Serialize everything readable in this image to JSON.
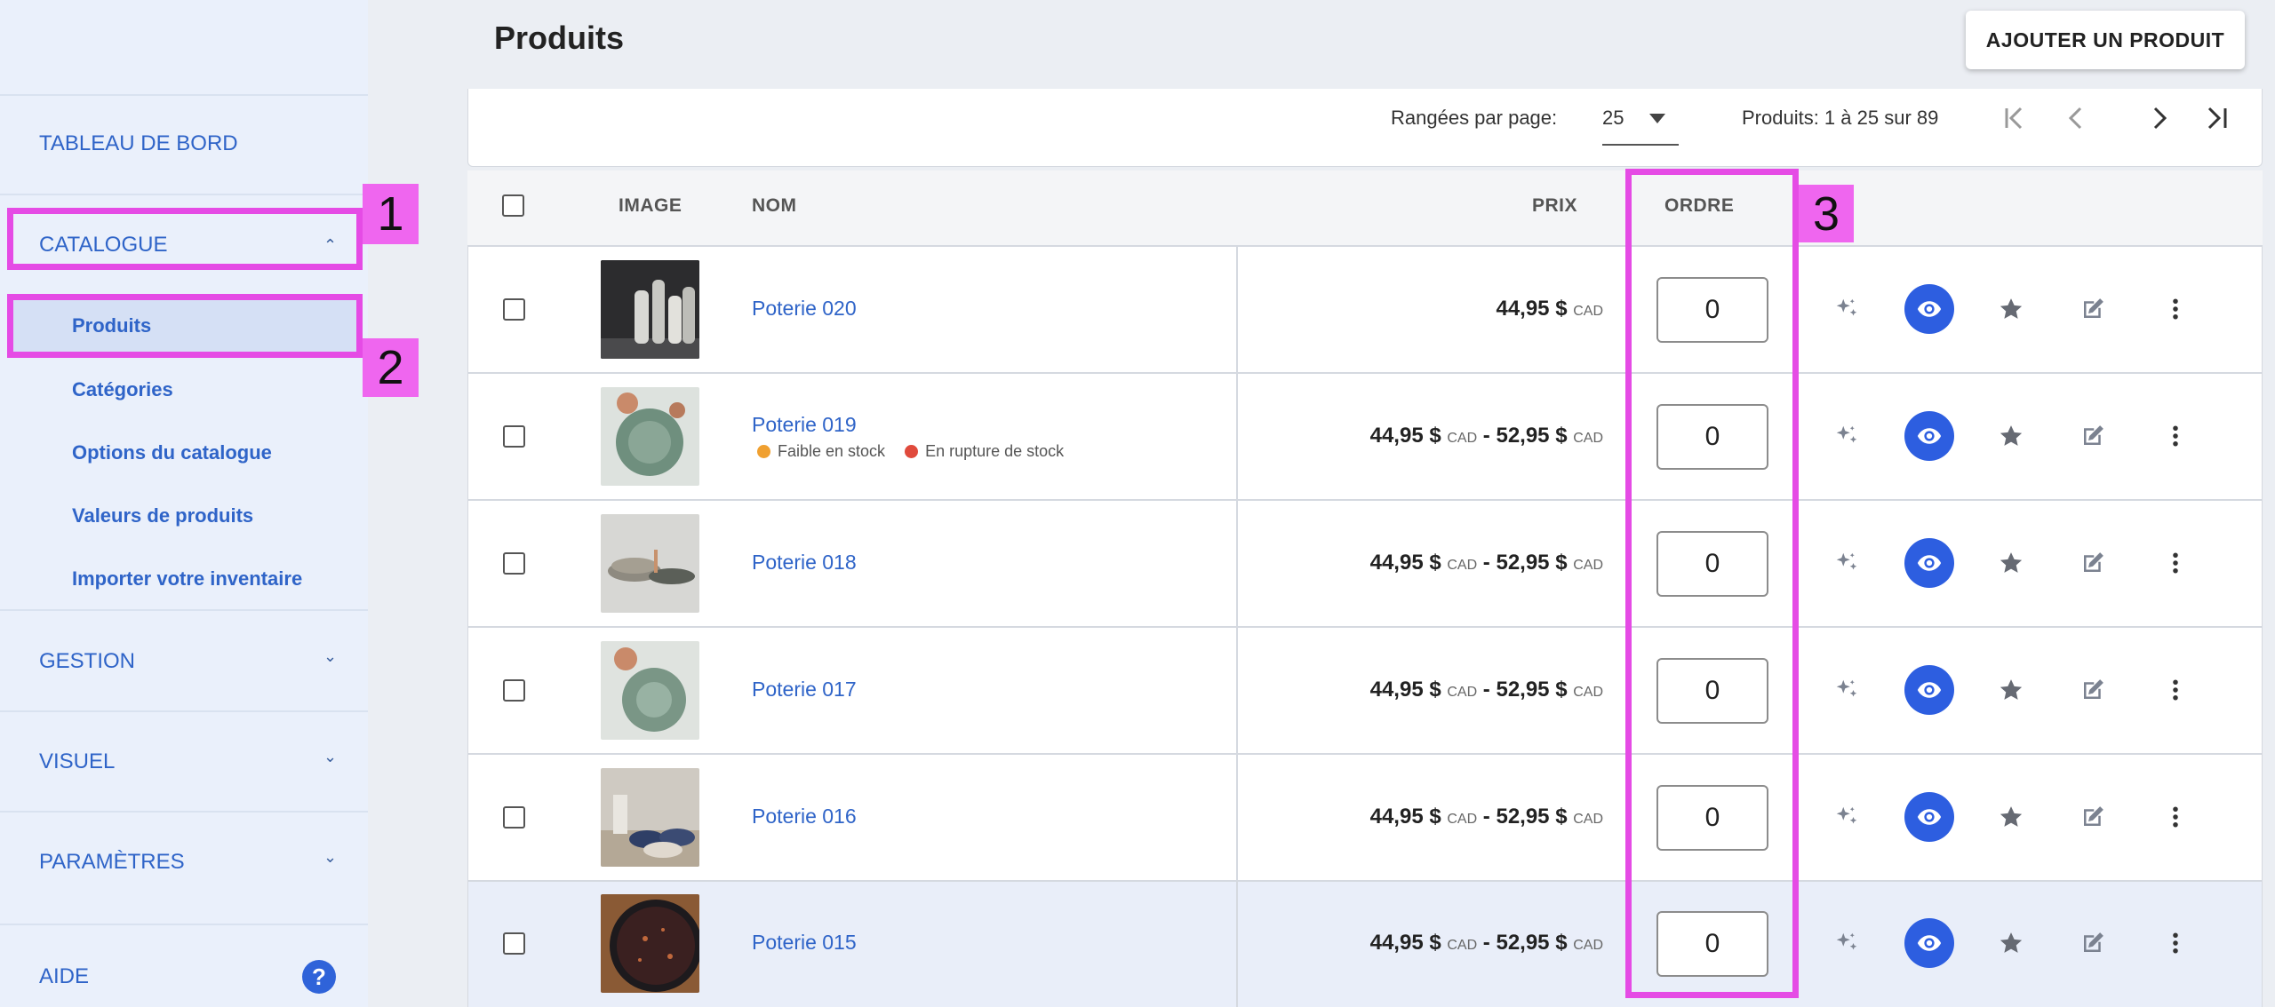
{
  "sidebar": {
    "dashboard": "TABLEAU DE BORD",
    "catalogue": "CATALOGUE",
    "catalogue_items": [
      "Produits",
      "Catégories",
      "Options du catalogue",
      "Valeurs de produits",
      "Importer votre inventaire"
    ],
    "gestion": "GESTION",
    "visuel": "VISUEL",
    "parametres": "PARAMÈTRES",
    "aide": "AIDE",
    "help_glyph": "?",
    "chevron_up": "⌃",
    "chevron_down": "⌄"
  },
  "header": {
    "title": "Produits",
    "add_button": "AJOUTER UN PRODUIT"
  },
  "pagination": {
    "rows_per_page_label": "Rangées par page:",
    "rows_per_page_value": "25",
    "info": "Produits: 1 à 25 sur 89"
  },
  "table": {
    "headers": {
      "image": "IMAGE",
      "name": "NOM",
      "price": "PRIX",
      "order": "ORDRE"
    },
    "rows": [
      {
        "name": "Poterie 020",
        "price_from": "44,95 $",
        "price_to": "",
        "currency": "CAD",
        "order": "0",
        "badges": []
      },
      {
        "name": "Poterie 019",
        "price_from": "44,95 $",
        "price_to": "52,95 $",
        "currency": "CAD",
        "order": "0",
        "badges": [
          {
            "label": "Faible en stock",
            "color": "#f0a030"
          },
          {
            "label": "En rupture de stock",
            "color": "#e04a3c"
          }
        ]
      },
      {
        "name": "Poterie 018",
        "price_from": "44,95 $",
        "price_to": "52,95 $",
        "currency": "CAD",
        "order": "0",
        "badges": []
      },
      {
        "name": "Poterie 017",
        "price_from": "44,95 $",
        "price_to": "52,95 $",
        "currency": "CAD",
        "order": "0",
        "badges": []
      },
      {
        "name": "Poterie 016",
        "price_from": "44,95 $",
        "price_to": "52,95 $",
        "currency": "CAD",
        "order": "0",
        "badges": []
      },
      {
        "name": "Poterie 015",
        "price_from": "44,95 $",
        "price_to": "52,95 $",
        "currency": "CAD",
        "order": "0",
        "badges": []
      }
    ],
    "price_separator": " - "
  },
  "annotations": [
    "1",
    "2",
    "3"
  ],
  "colors": {
    "accent": "#2f64c8",
    "annotation": "#e54be5",
    "eye_button": "#2d5ee0"
  }
}
